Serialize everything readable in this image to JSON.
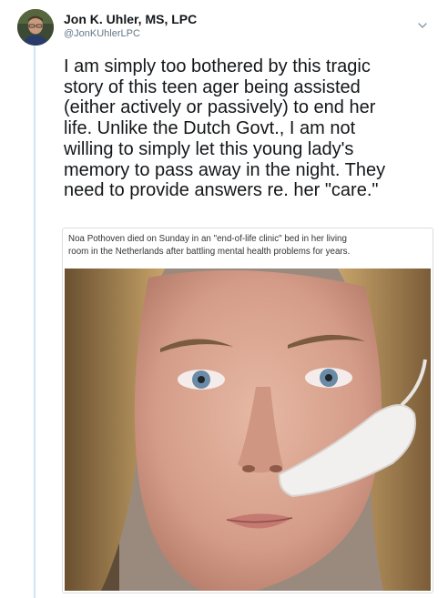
{
  "tweet": {
    "author": {
      "display_name": "Jon K. Uhler, MS, LPC",
      "handle": "@JonKUhlerLPC"
    },
    "text_lines": [
      "I am simply too bothered by this tragic",
      "story of this teen ager being assisted",
      "(either actively or passively) to end her",
      "life. Unlike the Dutch Govt., I am not",
      "willing to simply let this young lady's",
      "memory to pass away in the night. They",
      "need to provide answers re. her \"care.\""
    ],
    "media": {
      "caption_lines": [
        "Noa Pothoven died on Sunday in an \"end-of-life clinic\" bed in her living",
        "room in the Netherlands after battling mental health problems for years."
      ]
    }
  },
  "icons": {
    "caret": "chevron-down-icon"
  },
  "colors": {
    "thread_line": "#cfe6f5",
    "text": "#14171a",
    "secondary_text": "#657786"
  }
}
